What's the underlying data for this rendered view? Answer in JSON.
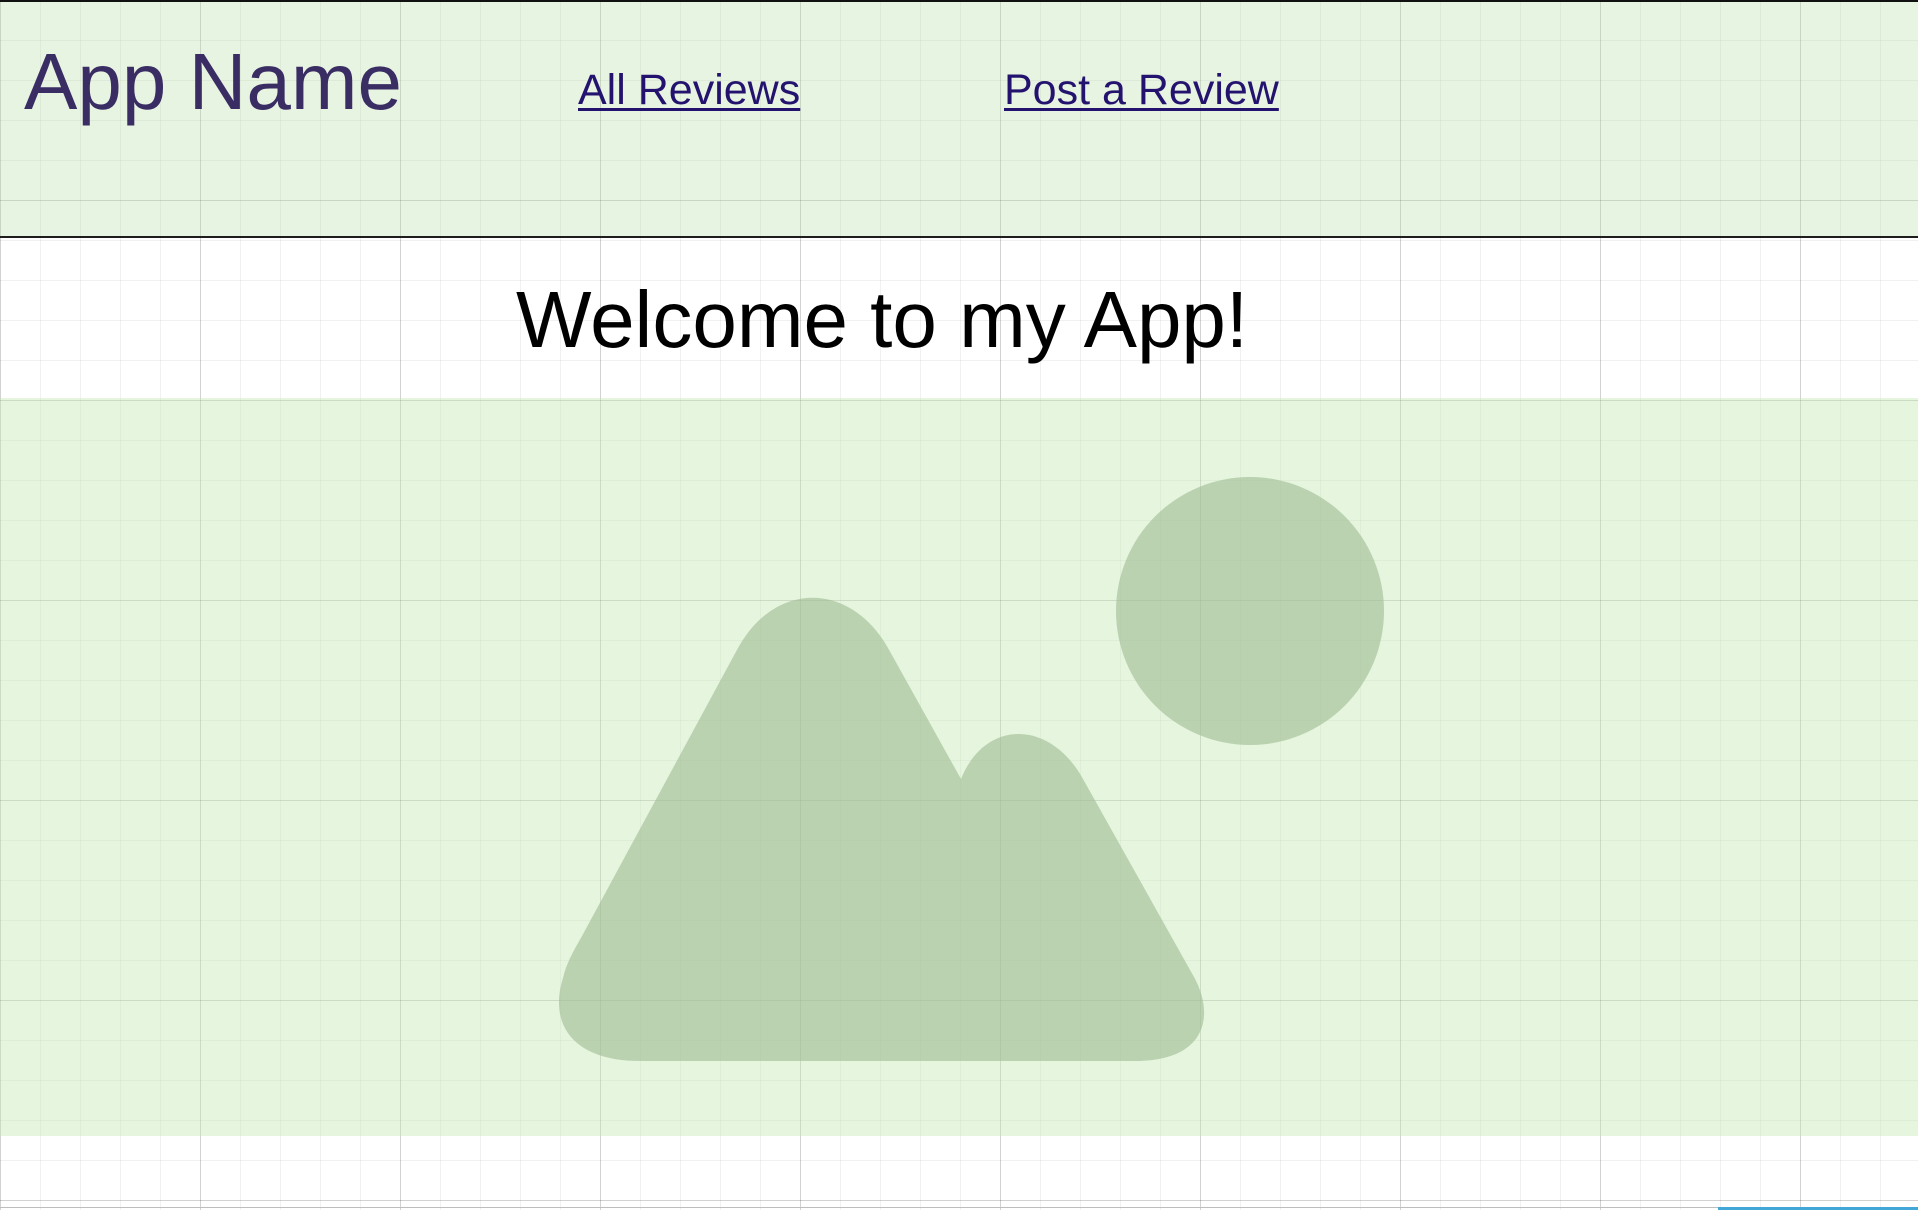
{
  "header": {
    "app_name": "App Name",
    "nav": [
      {
        "label": "All Reviews"
      },
      {
        "label": "Post a Review"
      }
    ]
  },
  "main": {
    "welcome_heading": "Welcome to my App!",
    "hero_image": {
      "icon": "image-placeholder-icon"
    }
  },
  "colors": {
    "header_bg": "#e6f1df",
    "hero_bg": "#e2f1d8",
    "placeholder_shape": "#b7cdaf",
    "brand_text": "#3a2d63",
    "link": "#24136e"
  }
}
